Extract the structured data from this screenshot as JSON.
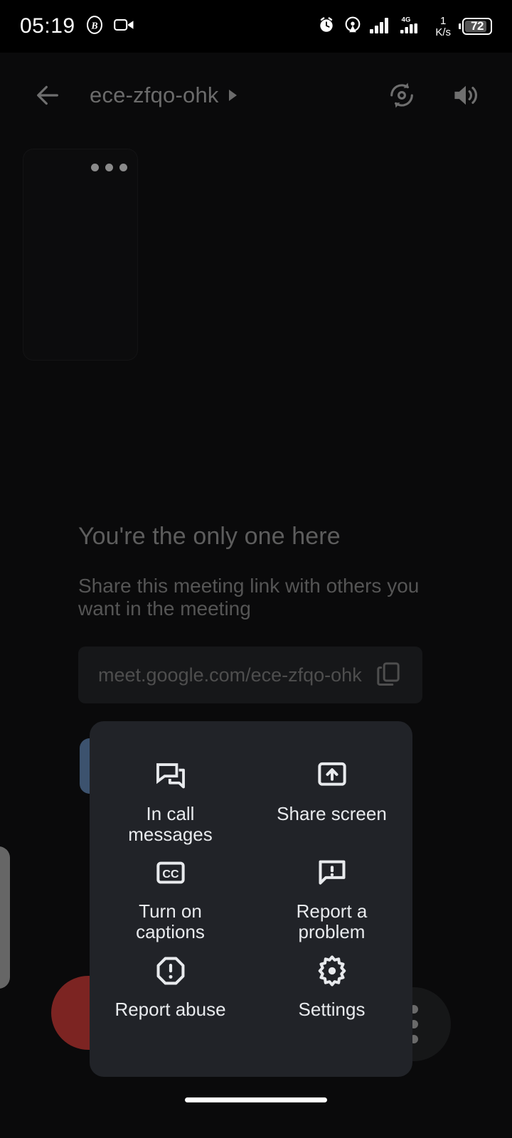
{
  "status_bar": {
    "time": "05:19",
    "left_icons": [
      "bitcoin-circle-icon",
      "video-camera-icon"
    ],
    "right_icons": [
      "alarm-clock-icon",
      "location-icon",
      "signal-bars-icon",
      "4g-signal-icon"
    ],
    "network_label": "4G",
    "net_speed_value": "1",
    "net_speed_unit": "K/s",
    "battery_percent": "72"
  },
  "top_bar": {
    "back_label": "back-arrow",
    "meeting_code": "ece-zfqo-ohk",
    "expand_indicator": "triangle-right",
    "switch_camera_label": "switch-camera",
    "speaker_label": "speaker"
  },
  "self_view": {
    "more_options_label": "more-options"
  },
  "main": {
    "heading": "You're the only one here",
    "description": "Share this meeting link with others you want in the meeting",
    "meeting_link": "meet.google.com/ece-zfqo-ohk",
    "copy_label": "copy-link"
  },
  "sheet": {
    "items": [
      {
        "label": "In call messages",
        "icon": "chat-bubbles-icon"
      },
      {
        "label": "Share screen",
        "icon": "share-screen-icon"
      },
      {
        "label": "Turn on captions",
        "icon": "closed-captions-icon"
      },
      {
        "label": "Report a problem",
        "icon": "feedback-icon"
      },
      {
        "label": "Report abuse",
        "icon": "report-abuse-icon"
      },
      {
        "label": "Settings",
        "icon": "gear-icon"
      }
    ]
  },
  "background_controls": {
    "end_call_label": "end-call",
    "more_label": "more-options",
    "blue_button_label": "raise-hand",
    "handle_label": "drag-handle"
  },
  "colors": {
    "screen_bg": "#0a0a0b",
    "sheet_bg": "#212328",
    "end_call_red": "#7c2422",
    "accent_blue": "#3c526e",
    "text_primary": "#e8eaed",
    "text_dim": "#5d5d5d"
  }
}
